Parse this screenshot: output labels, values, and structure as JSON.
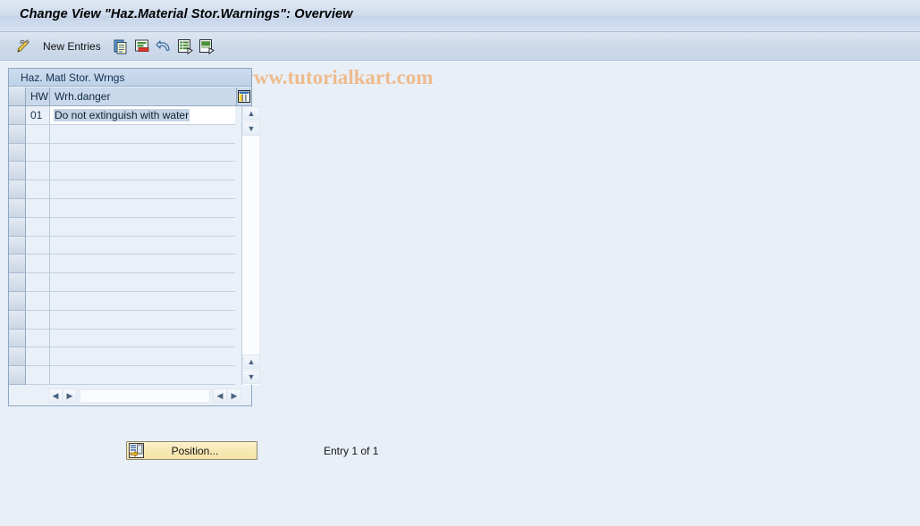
{
  "window": {
    "title": "Change View \"Haz.Material Stor.Warnings\": Overview"
  },
  "toolbar": {
    "display_change_icon": "pencil-icon",
    "new_entries_label": "New Entries",
    "buttons": [
      {
        "icon": "copy-icon",
        "name": "copy-as-button"
      },
      {
        "icon": "delete-icon",
        "name": "delete-button"
      },
      {
        "icon": "undo-icon",
        "name": "undo-button"
      },
      {
        "icon": "select-all-icon",
        "name": "select-all-button"
      },
      {
        "icon": "deselect-all-icon",
        "name": "deselect-all-button"
      }
    ]
  },
  "watermark": {
    "symbol": "©",
    "text": "www.tutorialkart.com",
    "color": "#eebb8d"
  },
  "table": {
    "panel_title": "Haz. Matl Stor. Wrngs",
    "settings_icon": "table-settings-icon",
    "columns": [
      {
        "key": "hw",
        "label": "HW"
      },
      {
        "key": "text",
        "label": "Wrh.danger"
      }
    ],
    "rows": [
      {
        "hw": "01",
        "text": "Do not extinguish with water",
        "selected": true
      },
      {
        "hw": "",
        "text": ""
      },
      {
        "hw": "",
        "text": ""
      },
      {
        "hw": "",
        "text": ""
      },
      {
        "hw": "",
        "text": ""
      },
      {
        "hw": "",
        "text": ""
      },
      {
        "hw": "",
        "text": ""
      },
      {
        "hw": "",
        "text": ""
      },
      {
        "hw": "",
        "text": ""
      },
      {
        "hw": "",
        "text": ""
      },
      {
        "hw": "",
        "text": ""
      },
      {
        "hw": "",
        "text": ""
      },
      {
        "hw": "",
        "text": ""
      },
      {
        "hw": "",
        "text": ""
      },
      {
        "hw": "",
        "text": ""
      }
    ],
    "scroll": {
      "up_glyph": "▲",
      "down_glyph": "▼",
      "left_glyph": "◀",
      "right_glyph": "▶"
    }
  },
  "footer": {
    "position_button_label": "Position...",
    "position_button_icon": "position-icon",
    "entry_count": "Entry 1 of 1"
  }
}
